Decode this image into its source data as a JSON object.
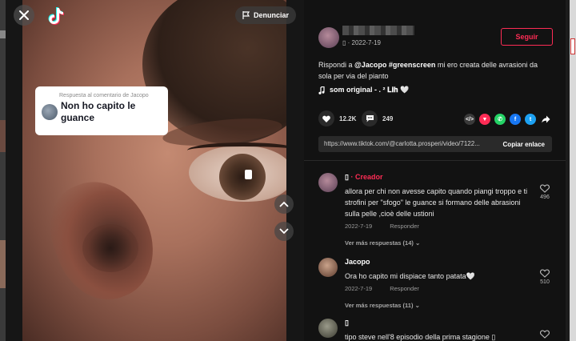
{
  "video": {
    "report_label": "Denunciar",
    "reply_card": {
      "subtitle": "Respuesta al comentario de Jacopo",
      "text": "Non ho capito le guance"
    }
  },
  "post": {
    "author_meta": "▯ · 2022-7-19",
    "follow_label": "Seguir",
    "caption": {
      "prefix": "Rispondi a ",
      "mention": "@Jacopo",
      "hashtag": "#greenscreen",
      "text": " mi ero creata delle avrasioni da sola per via del pianto"
    },
    "music": "som original - . ² 𝐋𝐢𝐡 🤍",
    "likes": "12.2K",
    "comments": "249",
    "share_icons": [
      "embed-icon",
      "tiktok-share-icon",
      "whatsapp-icon",
      "facebook-icon",
      "twitter-icon",
      "forward-icon"
    ],
    "link_url": "https://www.tiktok.com/@carlotta.prosperi/video/7122...",
    "copy_label": "Copiar enlace"
  },
  "comments": [
    {
      "name": "▯",
      "badge": " · Creador",
      "text": "allora per chi non avesse capito quando piangi troppo e ti strofini per \"sfogo\" le guance si formano delle abrasioni sulla pelle ,cioè delle ustioni",
      "date": "2022-7-19",
      "reply": "Responder",
      "likes": "496",
      "more": "Ver más respuestas (14)"
    },
    {
      "name": "Jacopo",
      "badge": "",
      "text": "Ora ho capito mi dispiace tanto patata🤍",
      "date": "2022-7-19",
      "reply": "Responder",
      "likes": "510",
      "more": "Ver más respuestas (11)"
    },
    {
      "name": "▯",
      "badge": "",
      "text": "tipo steve nell'8 episodio della prima stagione ▯",
      "date": "",
      "reply": "",
      "likes": "",
      "more": ""
    }
  ],
  "colors": {
    "accent": "#fe2c55",
    "panel_bg": "#121212"
  }
}
